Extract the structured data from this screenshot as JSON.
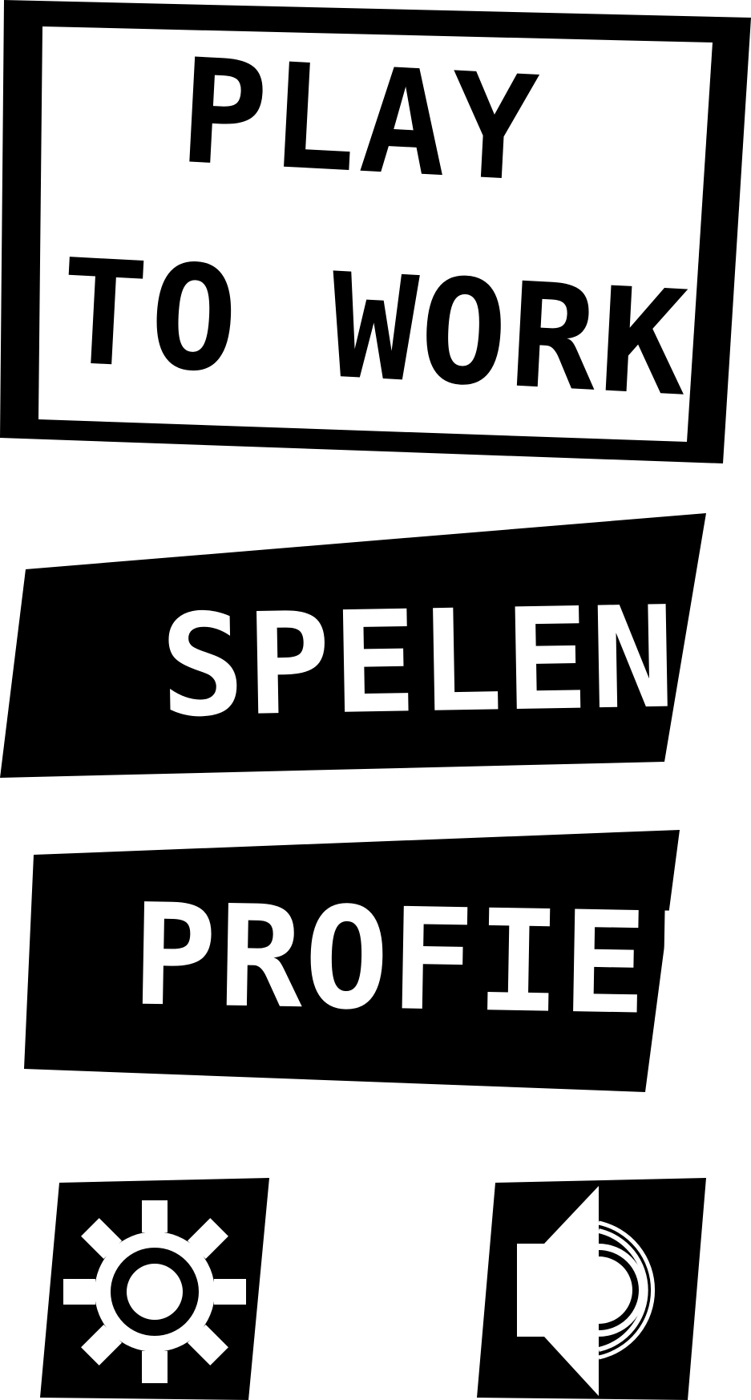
{
  "title": {
    "line1": "PLAY",
    "line2": "TO WORK"
  },
  "menu": {
    "play_label": "SPELEN",
    "profile_label": "PROFIEL"
  },
  "icons": {
    "settings": "gear-icon",
    "sound": "speaker-icon"
  },
  "colors": {
    "ink": "#000000",
    "paper": "#ffffff"
  }
}
